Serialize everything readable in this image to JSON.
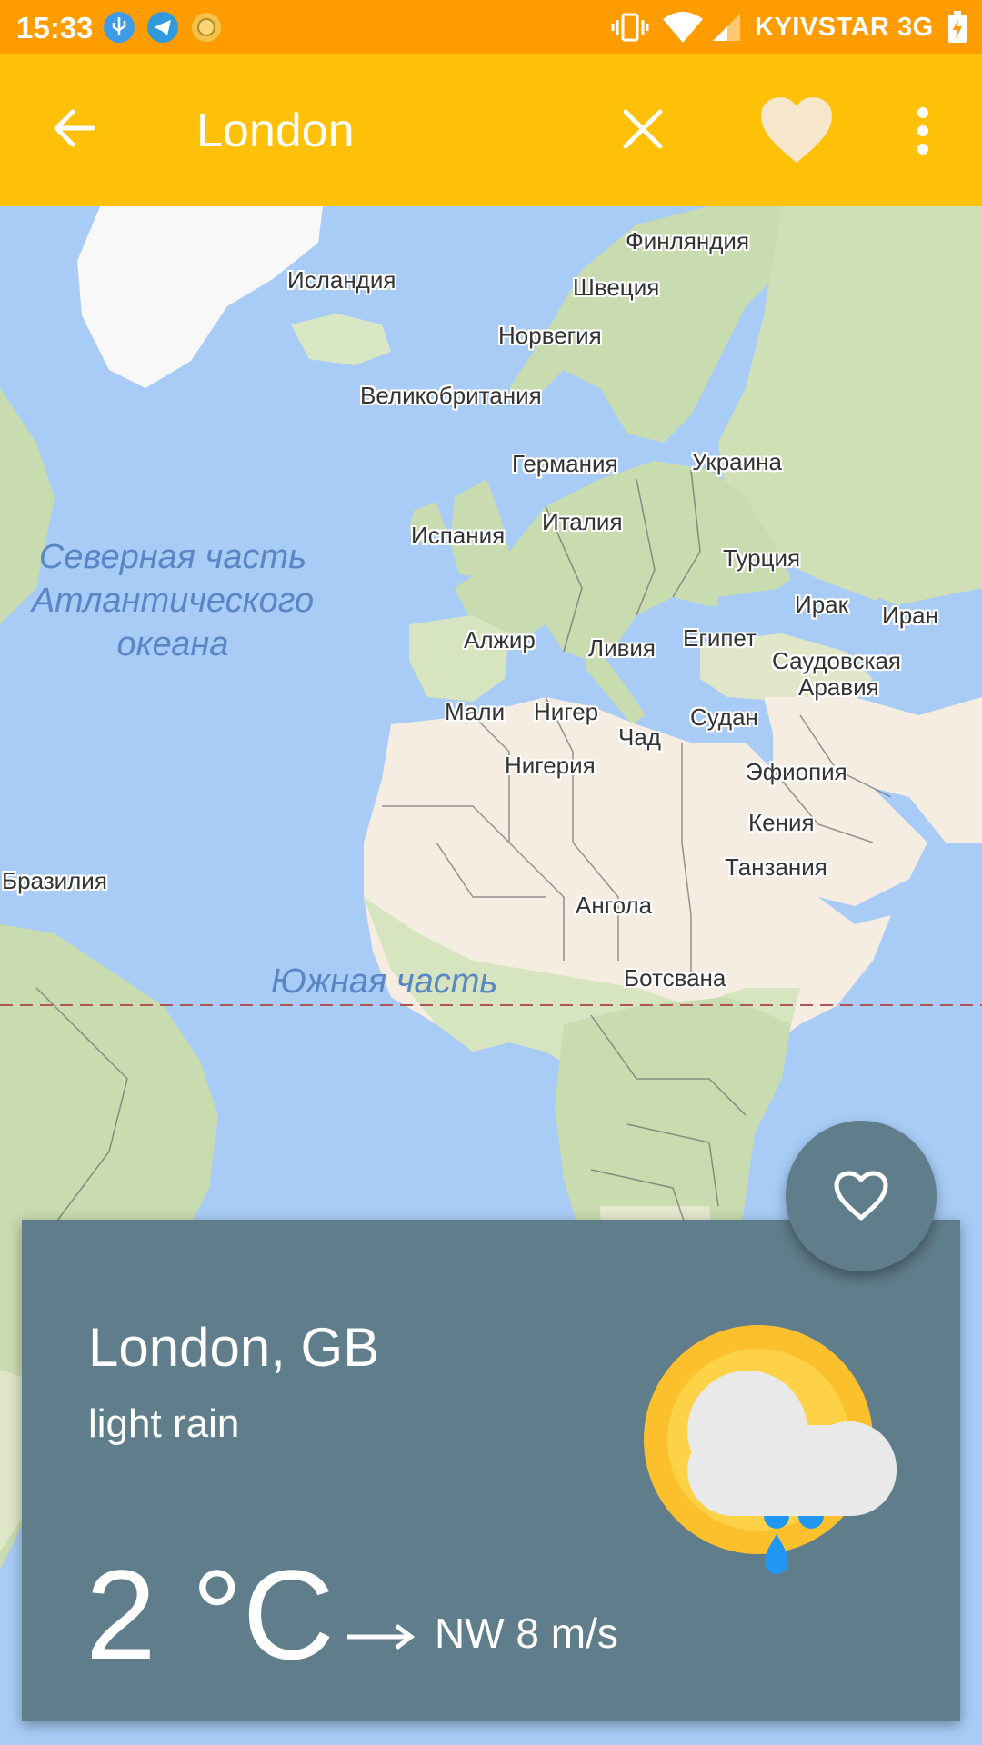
{
  "status_bar": {
    "time": "15:33",
    "carrier": "KYIVSTAR 3G",
    "icons": [
      "usb-icon",
      "telegram-icon",
      "notification-icon",
      "vibrate-icon",
      "wifi-icon",
      "signal-icon",
      "battery-charging-icon"
    ]
  },
  "app_bar": {
    "title": "London",
    "back_icon": "arrow-back-icon",
    "clear_icon": "close-icon",
    "favorite_icon": "heart-filled-icon",
    "menu_icon": "more-vert-icon",
    "color": "#ffc107"
  },
  "map": {
    "countries": {
      "finland": "Финляндия",
      "iceland": "Исландия",
      "sweden": "Швеция",
      "norway": "Норвегия",
      "uk": "Великобритания",
      "germany": "Германия",
      "ukraine": "Украина",
      "spain": "Испания",
      "italy": "Италия",
      "turkey": "Турция",
      "iraq": "Ирак",
      "iran": "Иран",
      "algeria": "Алжир",
      "libya": "Ливия",
      "egypt": "Египет",
      "saudi_arabia_line1": "Саудовская",
      "saudi_arabia_line2": "Аравия",
      "mali": "Мали",
      "niger": "Нигер",
      "sudan": "Судан",
      "chad": "Чад",
      "nigeria": "Нигерия",
      "ethiopia": "Эфиопия",
      "kenya": "Кения",
      "tanzania": "Танзания",
      "brazil": "Бразилия",
      "angola": "Ангола",
      "botswana": "Ботсвана"
    },
    "ocean_north": [
      "Северная часть",
      "Атлантического",
      "океана"
    ],
    "ocean_south": "Южная часть"
  },
  "fab": {
    "icon": "heart-outline-icon"
  },
  "weather": {
    "city": "London, GB",
    "description": "light rain",
    "temperature": "2 °C",
    "wind": "NW 8 m/s",
    "wind_icon": "arrow-right-icon",
    "weather_icon": "sun-cloud-rain-icon",
    "card_color": "#607d8b"
  }
}
